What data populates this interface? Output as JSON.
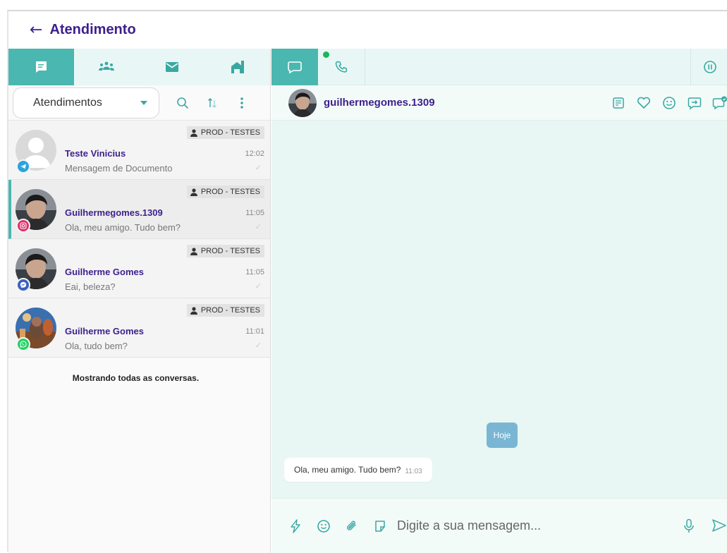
{
  "header": {
    "back_icon": "arrow-left-icon",
    "title": "Atendimento"
  },
  "left_tabs": [
    {
      "icon": "chat-icon",
      "active": true
    },
    {
      "icon": "team-icon",
      "active": false
    },
    {
      "icon": "mail-icon",
      "active": false
    },
    {
      "icon": "building-icon",
      "active": false
    }
  ],
  "toolbar": {
    "filter_label": "Atendimentos"
  },
  "conversations": [
    {
      "name": "Teste Vinicius",
      "queue": "PROD - TESTES",
      "time": "12:02",
      "preview": "Mensagem de Documento",
      "channel": "telegram",
      "channel_color": "#2aa3dc",
      "selected": false
    },
    {
      "name": "Guilhermegomes.1309",
      "queue": "PROD - TESTES",
      "time": "11:05",
      "preview": "Ola, meu amigo. Tudo bem?",
      "channel": "instagram",
      "channel_color": "#e1306c",
      "selected": true
    },
    {
      "name": "Guilherme Gomes",
      "queue": "PROD - TESTES",
      "time": "11:05",
      "preview": "Eai, beleza?",
      "channel": "messenger",
      "channel_color": "#3b5fc0",
      "selected": false
    },
    {
      "name": "Guilherme Gomes",
      "queue": "PROD - TESTES",
      "time": "11:01",
      "preview": "Ola, tudo bem?",
      "channel": "whatsapp",
      "channel_color": "#25d366",
      "selected": false
    }
  ],
  "showing_text": "Mostrando todas as conversas.",
  "chat": {
    "contact_name": "guilhermegomes.1309",
    "date_chip": "Hoje",
    "messages": [
      {
        "text": "Ola, meu amigo. Tudo bem?",
        "time": "11:03"
      }
    ],
    "composer_placeholder": "Digite a sua mensagem..."
  },
  "colors": {
    "accent": "#4ab7b0",
    "brand": "#3d1f8c",
    "panel_bg": "#e8f7f3"
  }
}
